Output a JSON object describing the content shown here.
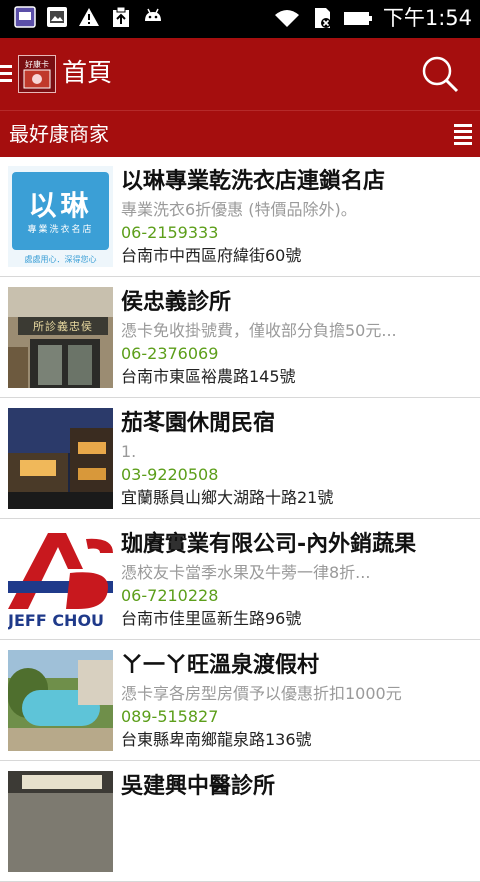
{
  "status_bar": {
    "time": "下午1:54",
    "icons": [
      "app-icon",
      "gallery-icon",
      "warning-icon",
      "clipboard-icon",
      "android-icon",
      "wifi-icon",
      "sd-card-icon",
      "battery-icon"
    ]
  },
  "action_bar": {
    "title": "首頁",
    "logo_text": "好康卡",
    "colors": {
      "primary": "#a50e0e",
      "phone": "#5c9e1a"
    }
  },
  "subheader": {
    "title": "最好康商家"
  },
  "merchants": [
    {
      "name": "以琳專業乾洗衣店連鎖名店",
      "desc": "專業洗衣6折優惠 (特價品除外)。",
      "phone": "06-2159333",
      "address": "台南市中西區府緯街60號",
      "thumb_text": "以琳",
      "thumb_sub": "專業洗衣名店",
      "thumb_foot": "處處用心．深得您心"
    },
    {
      "name": "侯忠義診所",
      "desc": "憑卡免收掛號費，僅收部分負擔50元...",
      "phone": "06-2376069",
      "address": "台南市東區裕農路145號",
      "thumb_sign": "所診義忠侯"
    },
    {
      "name": "茄苳園休閒民宿",
      "desc": "1.",
      "phone": "03-9220508",
      "address": "宜蘭縣員山鄉大湖路十路21號"
    },
    {
      "name": "珈賡實業有限公司-內外銷蔬果",
      "desc": "憑校友卡當季水果及牛蒡一律8折...",
      "phone": "06-7210228",
      "address": "台南市佳里區新生路96號",
      "thumb_brand": "JEFF CHOU"
    },
    {
      "name": "ㄚ一ㄚ旺溫泉渡假村",
      "desc": "憑卡享各房型房價予以優惠折扣1000元",
      "phone": "089-515827",
      "address": "台東縣卑南鄉龍泉路136號"
    },
    {
      "name": "吳建興中醫診所",
      "desc": "",
      "phone": "",
      "address": ""
    }
  ]
}
